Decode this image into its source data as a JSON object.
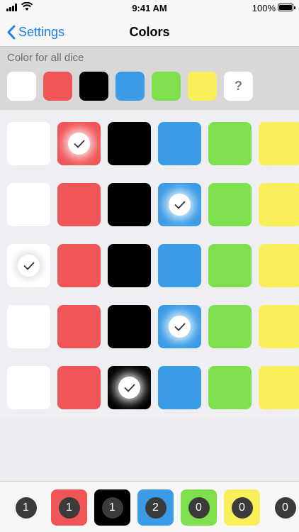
{
  "status_bar": {
    "time": "9:41 AM",
    "battery_percent": "100%"
  },
  "nav": {
    "back_label": "Settings",
    "title": "Colors"
  },
  "all_dice": {
    "label": "Color for all dice",
    "options": [
      {
        "name": "white",
        "color": "#ffffff"
      },
      {
        "name": "red",
        "color": "#f05558"
      },
      {
        "name": "black",
        "color": "#000000"
      },
      {
        "name": "blue",
        "color": "#3a9be6"
      },
      {
        "name": "green",
        "color": "#7fe04d"
      },
      {
        "name": "yellow",
        "color": "#f8ef5a"
      },
      {
        "name": "random",
        "color": "#ffffff",
        "symbol": "?"
      }
    ]
  },
  "palette": [
    "#ffffff",
    "#f05558",
    "#000000",
    "#3a9be6",
    "#7fe04d",
    "#f8ef5a"
  ],
  "dice_rows": [
    {
      "selected_color": "red"
    },
    {
      "selected_color": "blue"
    },
    {
      "selected_color": "white"
    },
    {
      "selected_color": "blue"
    },
    {
      "selected_color": "black"
    }
  ],
  "counts": [
    {
      "color_name": "none",
      "color": "transparent",
      "count": "1"
    },
    {
      "color_name": "red",
      "color": "#f05558",
      "count": "1"
    },
    {
      "color_name": "black",
      "color": "#000000",
      "count": "1"
    },
    {
      "color_name": "blue",
      "color": "#3a9be6",
      "count": "2"
    },
    {
      "color_name": "green",
      "color": "#7fe04d",
      "count": "0"
    },
    {
      "color_name": "yellow",
      "color": "#f8ef5a",
      "count": "0"
    },
    {
      "color_name": "none",
      "color": "transparent",
      "count": "0"
    }
  ]
}
